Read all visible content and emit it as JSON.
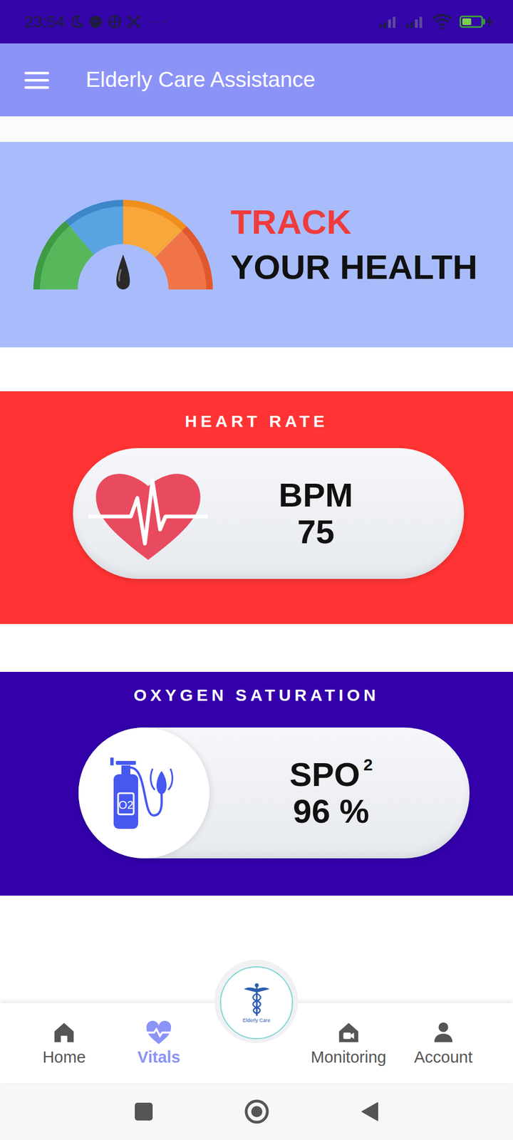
{
  "status_bar": {
    "time": "23:54",
    "more": "···",
    "battery": {
      "level": 0.5,
      "charging": true
    }
  },
  "app_bar": {
    "title": "Elderly Care Assistance"
  },
  "banner": {
    "line1": "TRACK",
    "line2": "YOUR HEALTH"
  },
  "vitals": [
    {
      "title": "HEART RATE",
      "label": "BPM",
      "value": "75",
      "color": "#ff3333"
    },
    {
      "title": "OXYGEN SATURATION",
      "label": "SPO",
      "label_sup": "2",
      "value": "96 %",
      "icon_text": "O2",
      "color": "#3300aa"
    }
  ],
  "center_logo": {
    "text": "Elderly Care"
  },
  "bottom_nav": [
    {
      "label": "Home",
      "selected": false
    },
    {
      "label": "Vitals",
      "selected": true
    },
    {
      "label": "Monitoring",
      "selected": false
    },
    {
      "label": "Account",
      "selected": false
    }
  ]
}
